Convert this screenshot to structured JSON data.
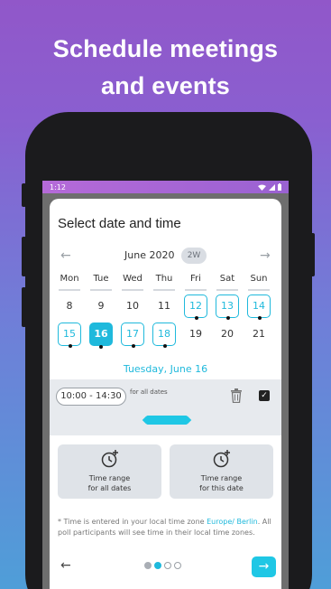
{
  "headline": {
    "line1": "Schedule meetings",
    "line2": "and events"
  },
  "status_bar": {
    "time": "1:12"
  },
  "card": {
    "title": "Select date and time"
  },
  "calendar": {
    "prev_arrow": "←",
    "next_arrow": "→",
    "month": "June 2020",
    "range_toggle": "2W",
    "weekdays": [
      "Mon",
      "Tue",
      "Wed",
      "Thu",
      "Fri",
      "Sat",
      "Sun"
    ],
    "week1": [
      "8",
      "9",
      "10",
      "11",
      "12",
      "13",
      "14"
    ],
    "week2": [
      "15",
      "16",
      "17",
      "18",
      "19",
      "20",
      "21"
    ],
    "selected_date_label": "Tuesday, June 16"
  },
  "time_slot": {
    "range": "10:00 - 14:30",
    "scope_note": "for all dates"
  },
  "options": {
    "all_dates": {
      "line1": "Time range",
      "line2": "for all dates"
    },
    "this_date": {
      "line1": "Time range",
      "line2": "for this date"
    }
  },
  "footer_note": {
    "prefix": "* Time is entered in your local time zone ",
    "timezone": "Europe/ Berlin",
    "suffix": ". All poll participants will see time in their local time zones."
  },
  "navigation": {
    "back": "←",
    "next": "→"
  }
}
